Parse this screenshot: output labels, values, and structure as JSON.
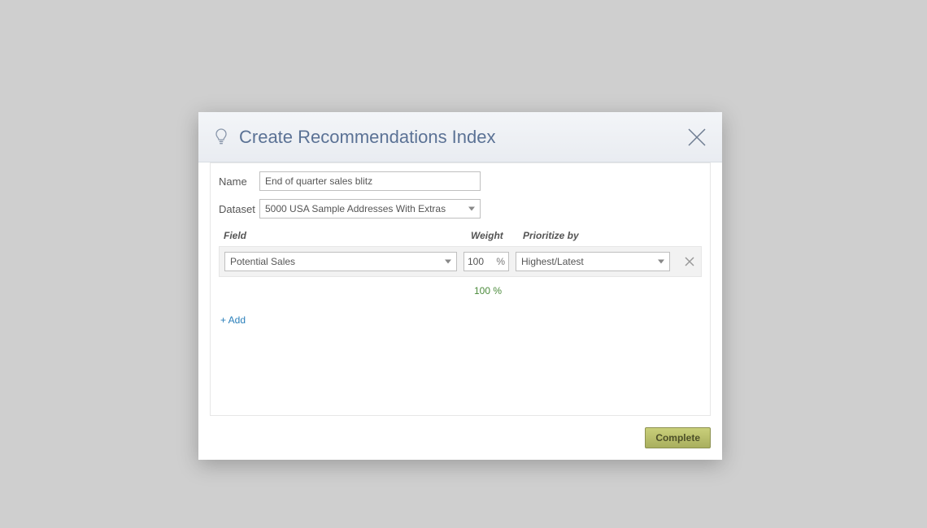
{
  "header": {
    "title": "Create Recommendations Index"
  },
  "form": {
    "name_label": "Name",
    "name_value": "End of quarter sales blitz",
    "dataset_label": "Dataset",
    "dataset_selected": "5000 USA Sample Addresses With Extras"
  },
  "grid": {
    "headers": {
      "field": "Field",
      "weight": "Weight",
      "prioritize": "Prioritize by"
    },
    "rows": [
      {
        "field": "Potential Sales",
        "weight": "100",
        "weight_unit": "%",
        "prioritize": "Highest/Latest"
      }
    ],
    "total_weight": "100 %"
  },
  "actions": {
    "add_label": "+ Add",
    "complete_label": "Complete"
  }
}
